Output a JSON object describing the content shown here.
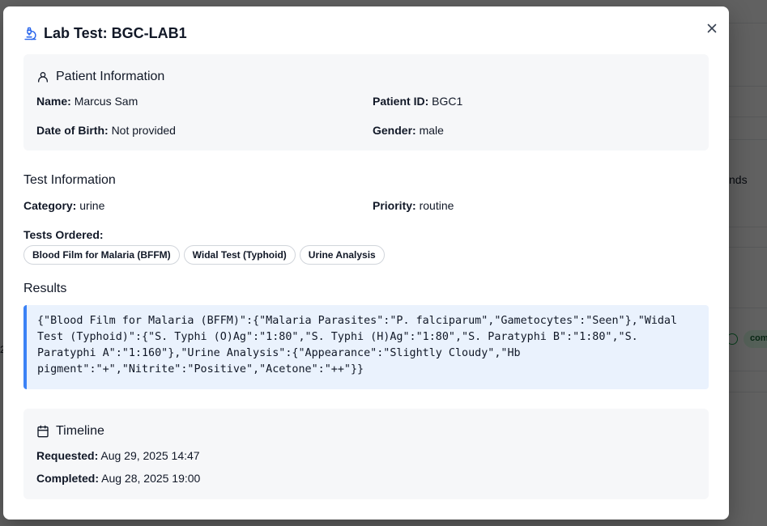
{
  "background": {
    "partial_text": "nds",
    "partial_status": "com",
    "partial_edge": "2"
  },
  "modal": {
    "title": "Lab Test: BGC-LAB1",
    "close_icon": "close-icon",
    "patient": {
      "heading": "Patient Information",
      "name_label": "Name:",
      "name_value": "Marcus Sam",
      "id_label": "Patient ID:",
      "id_value": "BGC1",
      "dob_label": "Date of Birth:",
      "dob_value": "Not provided",
      "gender_label": "Gender:",
      "gender_value": "male"
    },
    "test_info": {
      "heading": "Test Information",
      "category_label": "Category:",
      "category_value": "urine",
      "priority_label": "Priority:",
      "priority_value": "routine",
      "tests_ordered_label": "Tests Ordered:",
      "tests": [
        "Blood Film for Malaria (BFFM)",
        "Widal Test (Typhoid)",
        "Urine Analysis"
      ]
    },
    "results": {
      "heading": "Results",
      "text": "{\"Blood Film for Malaria (BFFM)\":{\"Malaria Parasites\":\"P. falciparum\",\"Gametocytes\":\"Seen\"},\"Widal Test (Typhoid)\":{\"S. Typhi (O)Ag\":\"1:80\",\"S. Typhi (H)Ag\":\"1:80\",\"S. Paratyphi B\":\"1:80\",\"S. Paratyphi A\":\"1:160\"},\"Urine Analysis\":{\"Appearance\":\"Slightly Cloudy\",\"Hb pigment\":\"+\",\"Nitrite\":\"Positive\",\"Acetone\":\"++\"}}"
    },
    "timeline": {
      "heading": "Timeline",
      "requested_label": "Requested:",
      "requested_value": "Aug 29, 2025 14:47",
      "completed_label": "Completed:",
      "completed_value": "Aug 28, 2025 19:00"
    }
  },
  "colors": {
    "accent": "#3b82f6",
    "results_bg": "#eaf2fd",
    "card_bg": "#f6f7f9"
  }
}
